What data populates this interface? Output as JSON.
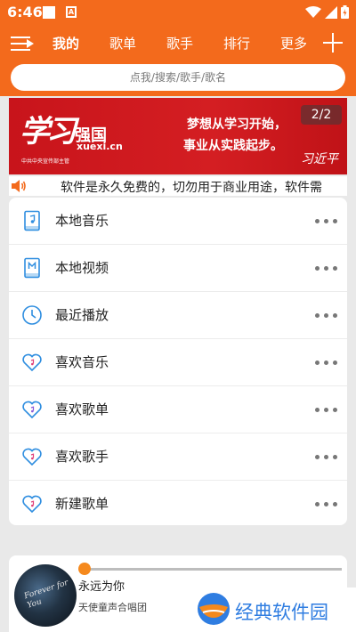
{
  "status": {
    "time": "6:46"
  },
  "nav": {
    "tabs": [
      "我的",
      "歌单",
      "歌手",
      "排行",
      "更多"
    ],
    "active_tab": "我的"
  },
  "search": {
    "placeholder": "点我/搜索/歌手/歌名"
  },
  "banner": {
    "logo_calligraphy": "学习",
    "brand": "强国",
    "domain": "xuexi.cn",
    "sub_caption": "中共中央宣传部主管",
    "motto_line1": "梦想从学习开始，",
    "motto_line2": "事业从实践起步。",
    "signature": "习近平",
    "page_indicator": "2/2"
  },
  "notice": {
    "text": "软件是永久免费的，切勿用于商业用途，软件需"
  },
  "menu": {
    "items": [
      {
        "label": "本地音乐",
        "icon": "music-file-icon"
      },
      {
        "label": "本地视频",
        "icon": "video-file-icon"
      },
      {
        "label": "最近播放",
        "icon": "clock-icon"
      },
      {
        "label": "喜欢音乐",
        "icon": "heart-music-icon"
      },
      {
        "label": "喜欢歌单",
        "icon": "heart-music-icon"
      },
      {
        "label": "喜欢歌手",
        "icon": "heart-music-icon"
      },
      {
        "label": "新建歌单",
        "icon": "heart-music-icon"
      }
    ]
  },
  "player": {
    "album_text": "Forever for You",
    "song_title": "永远为你",
    "artist": "天使童声合唱团",
    "progress": 0.0
  },
  "watermark": {
    "text": "经典软件园"
  },
  "colors": {
    "brand_orange": "#f36a1c",
    "banner_red": "#d41e22",
    "icon_blue": "#2f8ee0",
    "knob_orange": "#f5891d"
  }
}
